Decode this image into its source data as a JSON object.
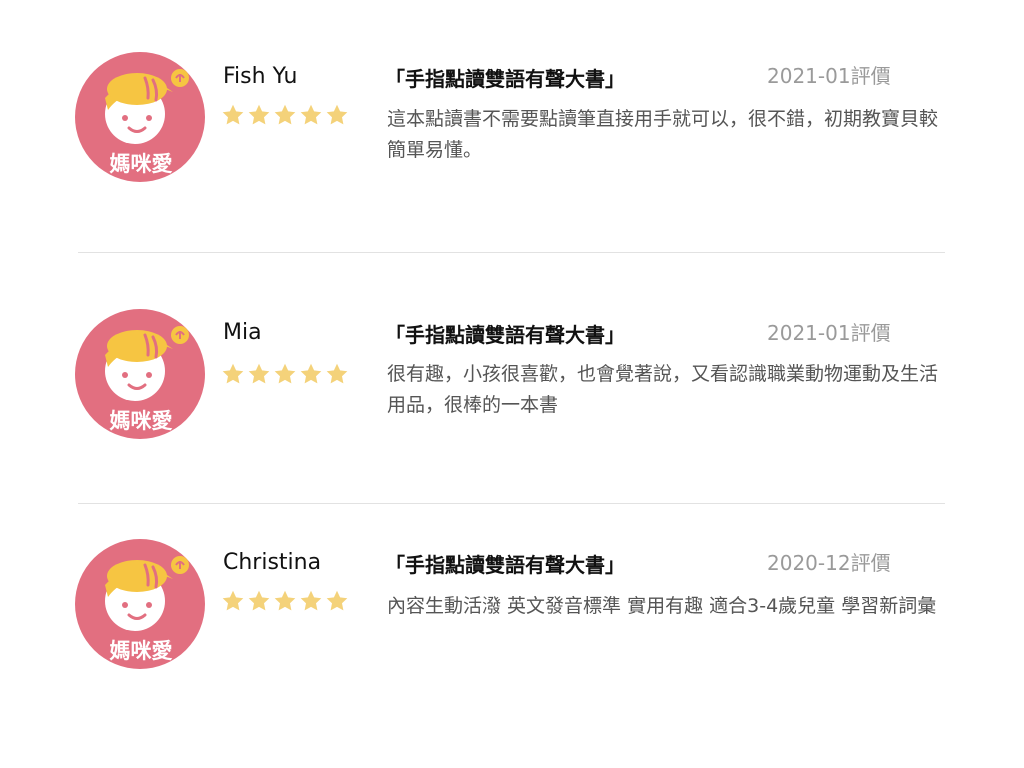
{
  "avatar_label": "媽咪愛",
  "colors": {
    "avatar_bg": "#e26f80",
    "hat": "#f6c542",
    "star": "#f4d27a"
  },
  "reviews": [
    {
      "name": "Fish Yu",
      "product": "「手指點讀雙語有聲大書」",
      "date": "2021-01評價",
      "rating": 5,
      "text": "這本點讀書不需要點讀筆直接用手就可以，很不錯，初期教寶貝較簡單易懂。"
    },
    {
      "name": "Mia",
      "product": "「手指點讀雙語有聲大書」",
      "date": "2021-01評價",
      "rating": 5,
      "text": "很有趣，小孩很喜歡，也會覺著說，又看認識職業動物運動及生活用品，很棒的一本書"
    },
    {
      "name": "Christina",
      "product": "「手指點讀雙語有聲大書」",
      "date": "2020-12評價",
      "rating": 5,
      "text": "內容生動活潑  英文發音標準  實用有趣  適合3-4歲兒童  學習新詞彙"
    }
  ]
}
